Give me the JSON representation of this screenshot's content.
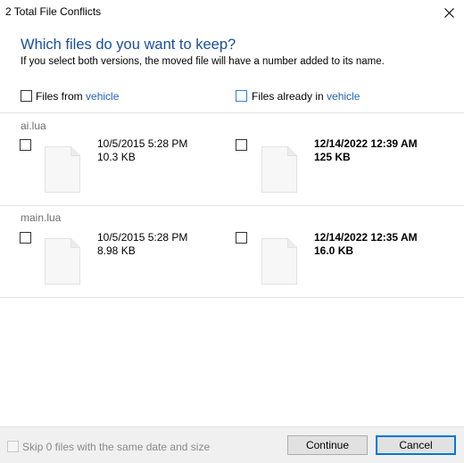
{
  "window": {
    "title": "2 Total File Conflicts"
  },
  "dialog": {
    "heading": "Which files do you want to keep?",
    "subheading": "If you select both versions, the moved file will have a number added to its name."
  },
  "columns": {
    "source": {
      "prefix": "Files from ",
      "location": "vehicle"
    },
    "destination": {
      "prefix": "Files already in ",
      "location": "vehicle"
    }
  },
  "conflicts": [
    {
      "filename": "ai.lua",
      "source": {
        "date": "10/5/2015 5:28 PM",
        "size": "10.3 KB"
      },
      "destination": {
        "date": "12/14/2022 12:39 AM",
        "size": "125 KB"
      }
    },
    {
      "filename": "main.lua",
      "source": {
        "date": "10/5/2015 5:28 PM",
        "size": "8.98 KB"
      },
      "destination": {
        "date": "12/14/2022 12:35 AM",
        "size": "16.0 KB"
      }
    }
  ],
  "footer": {
    "skip_label": "Skip 0 files with the same date and size",
    "continue_label": "Continue",
    "cancel_label": "Cancel"
  }
}
